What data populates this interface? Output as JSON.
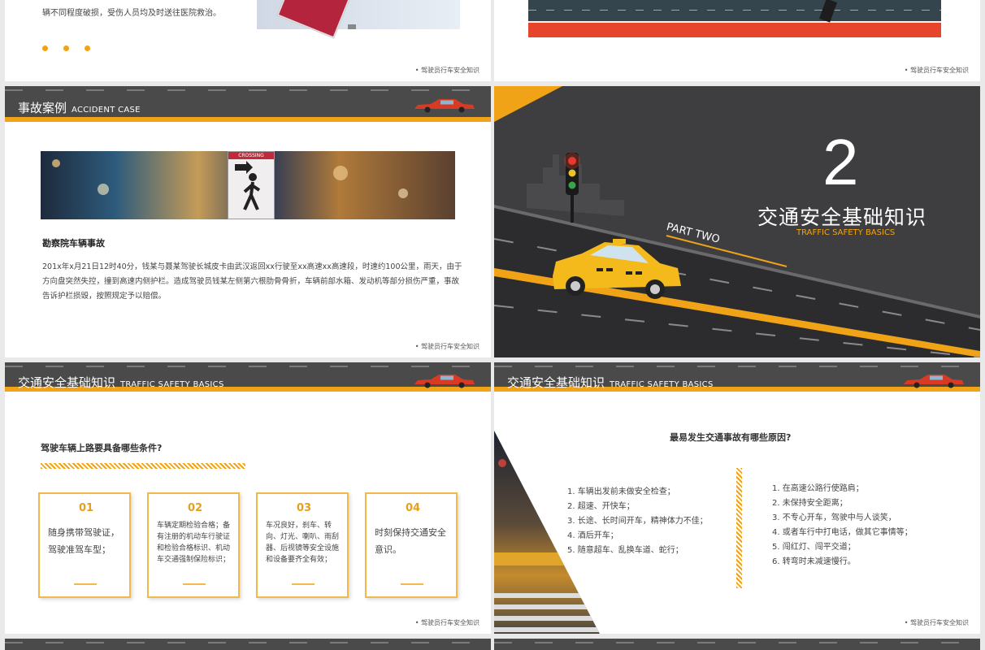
{
  "footer": "驾驶员行车安全知识",
  "slide_top_left": {
    "text_lines": [
      "辆不同程度破损，受伤人员均及时送往医院救治。"
    ]
  },
  "slide_accident": {
    "header_title": "事故案例",
    "header_en": "ACCIDENT CASE",
    "sign_text": "CROSSING",
    "case_title": "勘察院车辆事故",
    "case_body": "201x年x月21日12时40分，钱某与聂某驾驶长城皮卡由武汉返回xx行驶至xx高速xx高速段，时速约100公里，雨天，由于方向盘突然失控，撞到高速内侧护栏。造成驾驶员钱某左侧第六根肋骨骨折，车辆前部水箱、发动机等部分损伤严重，事故告诉护栏损毁，按照规定予以赔偿。"
  },
  "slide_part_two": {
    "number": "2",
    "title": "交通安全基础知识",
    "subtitle": "TRAFFIC SAFETY BASICS",
    "part_label": "PART TWO"
  },
  "slide_conditions": {
    "header_title": "交通安全基础知识",
    "header_en": "TRAFFIC SAFETY BASICS",
    "question": "驾驶车辆上路要具备哪些条件?",
    "cards": [
      {
        "num": "01",
        "text": "随身携带驾驶证，驾驶准驾车型；"
      },
      {
        "num": "02",
        "text": "车辆定期检验合格；备有注册的机动车行驶证和检验合格标识、机动车交通强制保险标识；"
      },
      {
        "num": "03",
        "text": "车况良好，刹车、转向、灯光、喇叭、雨刮器、后视镜等安全设施和设备要齐全有效；"
      },
      {
        "num": "04",
        "text": "时刻保持交通安全意识。"
      }
    ]
  },
  "slide_causes": {
    "header_title": "交通安全基础知识",
    "header_en": "TRAFFIC SAFETY BASICS",
    "question": "最易发生交通事故有哪些原因?",
    "left_list": [
      "1. 车辆出发前未做安全检查；",
      "2. 超速、开快车；",
      "3. 长途、长时间开车，精神体力不佳；",
      "4. 酒后开车；",
      "5. 随意超车、乱换车道、蛇行；"
    ],
    "right_list": [
      "1. 在高速公路行使路肩；",
      "2. 未保持安全距离；",
      "3. 不专心开车，驾驶中与人谈笑，",
      "4. 或者车行中打电话，做其它事情等；",
      "5. 闯红灯、闯平交道；",
      "6. 转弯时未减速慢行。"
    ]
  },
  "colors": {
    "accent": "#f0a316",
    "header_bg": "#4a4a4a",
    "dark_bg": "#3e3e40"
  }
}
